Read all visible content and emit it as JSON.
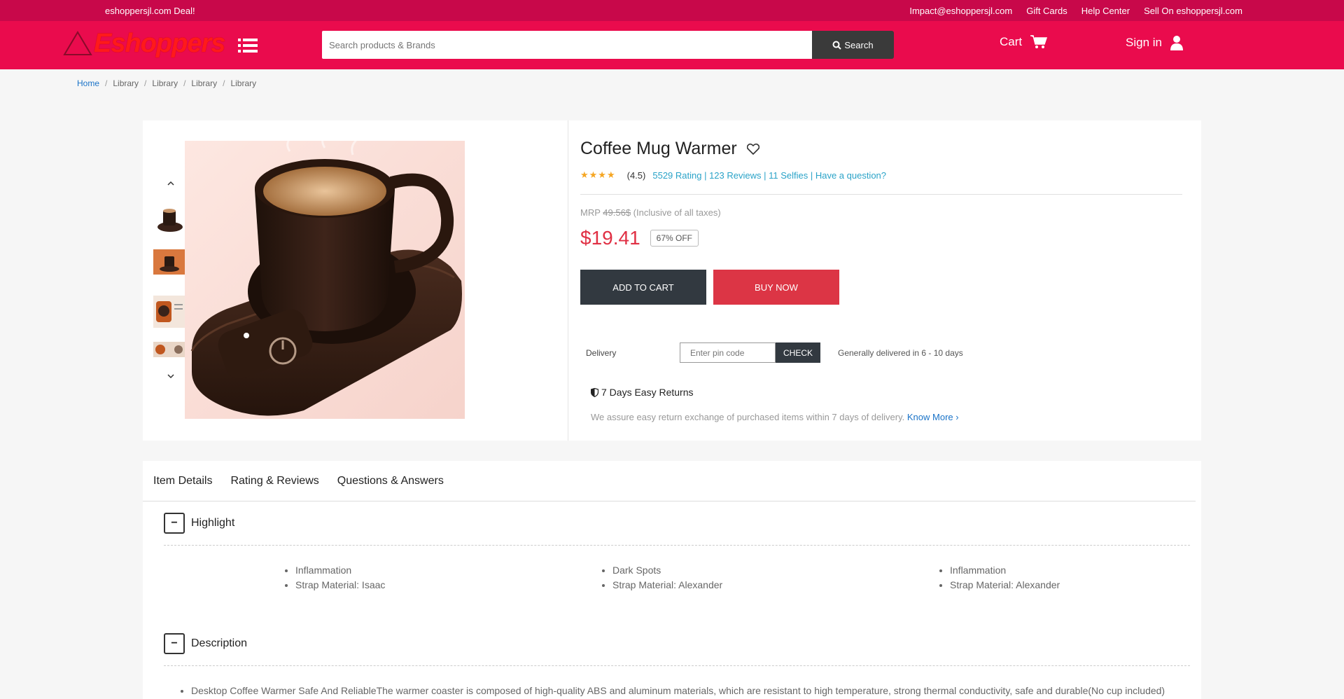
{
  "topstrip": {
    "deal": "eshoppersjl.com Deal!",
    "links": [
      "Impact@eshoppersjl.com",
      "Gift Cards",
      "Help Center",
      "Sell On eshoppersjl.com"
    ]
  },
  "header": {
    "logo": "Eshoppers",
    "search_placeholder": "Search products & Brands",
    "search_label": "Search",
    "cart_label": "Cart",
    "signin_label": "Sign in"
  },
  "breadcrumb": [
    "Home",
    "Library",
    "Library",
    "Library",
    "Library"
  ],
  "product": {
    "title": "Coffee Mug Warmer",
    "rating_value": "(4.5)",
    "rating_stars": 4.5,
    "rating_links": "5529 Rating | 123 Reviews | 11 Selfies | Have a question?",
    "mrp_label": "MRP",
    "mrp_value": "49.56$",
    "mrp_note": "(Inclusive of all taxes)",
    "price": "$19.41",
    "discount": "67% OFF",
    "add_to_cart": "ADD TO CART",
    "buy_now": "BUY NOW",
    "delivery_label": "Delivery",
    "pin_placeholder": "Enter pin code",
    "check_label": "CHECK",
    "delivery_info": "Generally delivered in 6 - 10 days",
    "returns_title": "7 Days Easy Returns",
    "returns_text": "We assure easy return exchange of purchased items within 7 days of delivery.",
    "know_more": "Know More"
  },
  "tabs": [
    "Item Details",
    "Rating & Reviews",
    "Questions & Answers"
  ],
  "highlight": {
    "title": "Highlight",
    "columns": [
      [
        "Inflammation",
        "Strap Material: Isaac"
      ],
      [
        "Dark Spots",
        "Strap Material: Alexander"
      ],
      [
        "Inflammation",
        "Strap Material: Alexander"
      ]
    ]
  },
  "description": {
    "title": "Description",
    "items": [
      "Desktop Coffee Warmer Safe And ReliableThe warmer coaster is composed of high-quality ABS and aluminum materials, which are resistant to high temperature, strong thermal conductivity, safe and durable(No cup included)"
    ]
  },
  "colors": {
    "top_strip": "#c8084a",
    "header": "#ea0b4d",
    "price": "#e03044",
    "buy_now": "#dc3545",
    "link": "#2aa3c8"
  }
}
